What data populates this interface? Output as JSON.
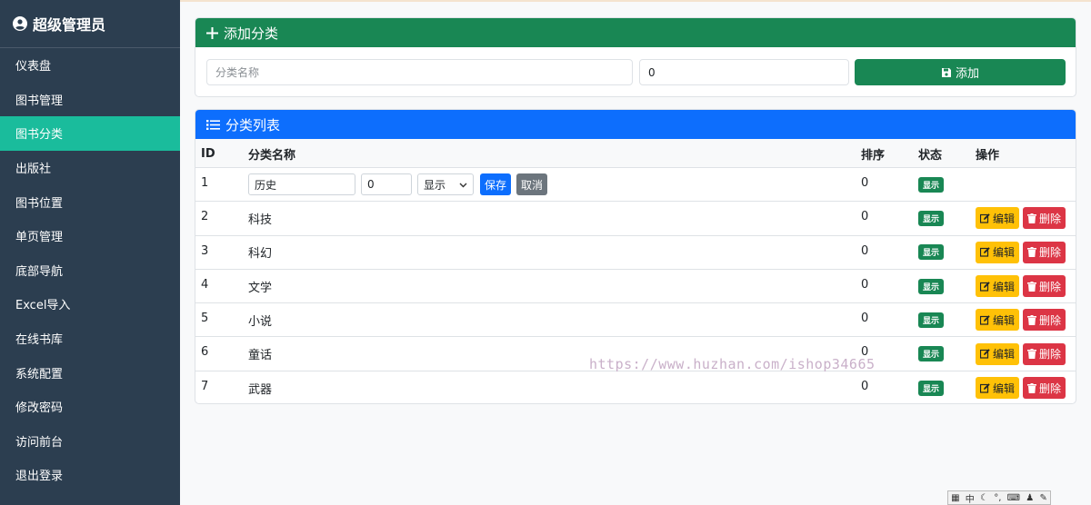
{
  "sidebar": {
    "brand": "超级管理员",
    "items": [
      {
        "label": "仪表盘",
        "active": false
      },
      {
        "label": "图书管理",
        "active": false
      },
      {
        "label": "图书分类",
        "active": true
      },
      {
        "label": "出版社",
        "active": false
      },
      {
        "label": "图书位置",
        "active": false
      },
      {
        "label": "单页管理",
        "active": false
      },
      {
        "label": "底部导航",
        "active": false
      },
      {
        "label": "Excel导入",
        "active": false
      },
      {
        "label": "在线书库",
        "active": false
      },
      {
        "label": "系统配置",
        "active": false
      },
      {
        "label": "修改密码",
        "active": false
      },
      {
        "label": "访问前台",
        "active": false
      },
      {
        "label": "退出登录",
        "active": false
      }
    ]
  },
  "add_card": {
    "title": "添加分类",
    "name_placeholder": "分类名称",
    "sort_value": "0",
    "add_label": "添加"
  },
  "list_card": {
    "title": "分类列表",
    "columns": {
      "id": "ID",
      "name": "分类名称",
      "sort": "排序",
      "status": "状态",
      "ops": "操作"
    },
    "edit_row": {
      "id": "1",
      "name_value": "历史",
      "sort_value": "0",
      "select_value": "显示",
      "save_label": "保存",
      "cancel_label": "取消",
      "sort": "0",
      "status": "显示"
    },
    "rows": [
      {
        "id": "2",
        "name": "科技",
        "sort": "0",
        "status": "显示"
      },
      {
        "id": "3",
        "name": "科幻",
        "sort": "0",
        "status": "显示"
      },
      {
        "id": "4",
        "name": "文学",
        "sort": "0",
        "status": "显示"
      },
      {
        "id": "5",
        "name": "小说",
        "sort": "0",
        "status": "显示"
      },
      {
        "id": "6",
        "name": "童话",
        "sort": "0",
        "status": "显示"
      },
      {
        "id": "7",
        "name": "武器",
        "sort": "0",
        "status": "显示"
      }
    ],
    "edit_label": "编辑",
    "delete_label": "删除"
  },
  "watermark": "https://www.huzhan.com/ishop34665",
  "ime_bar": {
    "lang": "中"
  },
  "colors": {
    "sidebar": "#2c3e50",
    "active": "#1abc9c",
    "green": "#198754",
    "blue": "#0d6efd",
    "warning": "#ffc107",
    "danger": "#dc3545"
  }
}
